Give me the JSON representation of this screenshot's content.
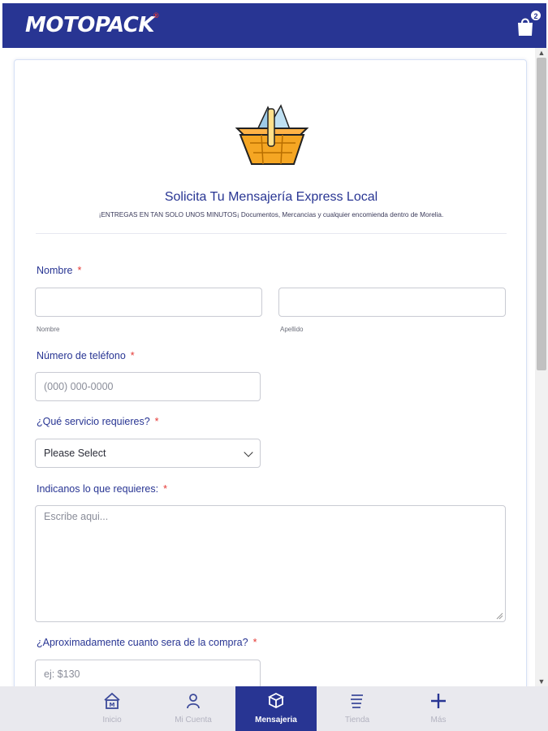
{
  "header": {
    "logo": "MOTOPACK",
    "logo_mark": "®",
    "cart_count": "2"
  },
  "form": {
    "title": "Solicita Tu Mensajería Express Local",
    "subtitle": "¡ENTREGAS EN TAN SOLO UNOS MINUTOS¡ Documentos, Mercancias y cualquier encomienda dentro de Morelia.",
    "name": {
      "label": "Nombre",
      "required": "*",
      "first_sublabel": "Nombre",
      "last_sublabel": "Apellido"
    },
    "phone": {
      "label": "Número de teléfono",
      "required": "*",
      "placeholder": "(000) 000-0000"
    },
    "service": {
      "label": "¿Qué servicio requieres?",
      "required": "*",
      "selected": "Please Select"
    },
    "details": {
      "label": "Indicanos lo que requieres:",
      "required": "*",
      "placeholder": "Escribe aqui..."
    },
    "amount": {
      "label": "¿Aproximadamente cuanto sera de la compra?",
      "required": "*",
      "placeholder": "ej: $130"
    }
  },
  "nav": {
    "items": [
      {
        "label": "Inicio",
        "icon": "home-icon"
      },
      {
        "label": "Mi Cuenta",
        "icon": "user-icon"
      },
      {
        "label": "Mensajeria",
        "icon": "package-icon"
      },
      {
        "label": "Tienda",
        "icon": "store-icon"
      },
      {
        "label": "Más",
        "icon": "plus-icon"
      }
    ],
    "active_index": 2
  },
  "colors": {
    "brand": "#283593",
    "required": "#e53935",
    "basket": "#f5a623"
  }
}
